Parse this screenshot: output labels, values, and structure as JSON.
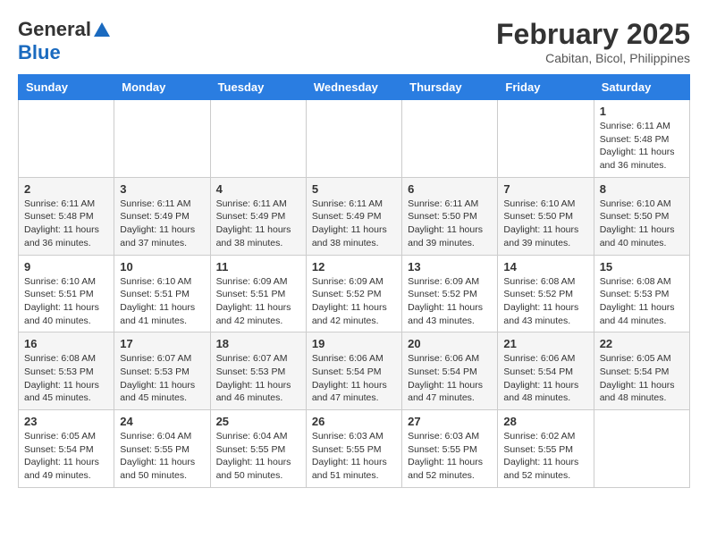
{
  "header": {
    "logo_general": "General",
    "logo_blue": "Blue",
    "month_title": "February 2025",
    "location": "Cabitan, Bicol, Philippines"
  },
  "days_of_week": [
    "Sunday",
    "Monday",
    "Tuesday",
    "Wednesday",
    "Thursday",
    "Friday",
    "Saturday"
  ],
  "weeks": [
    [
      {
        "day": "",
        "info": ""
      },
      {
        "day": "",
        "info": ""
      },
      {
        "day": "",
        "info": ""
      },
      {
        "day": "",
        "info": ""
      },
      {
        "day": "",
        "info": ""
      },
      {
        "day": "",
        "info": ""
      },
      {
        "day": "1",
        "info": "Sunrise: 6:11 AM\nSunset: 5:48 PM\nDaylight: 11 hours\nand 36 minutes."
      }
    ],
    [
      {
        "day": "2",
        "info": "Sunrise: 6:11 AM\nSunset: 5:48 PM\nDaylight: 11 hours\nand 36 minutes."
      },
      {
        "day": "3",
        "info": "Sunrise: 6:11 AM\nSunset: 5:49 PM\nDaylight: 11 hours\nand 37 minutes."
      },
      {
        "day": "4",
        "info": "Sunrise: 6:11 AM\nSunset: 5:49 PM\nDaylight: 11 hours\nand 38 minutes."
      },
      {
        "day": "5",
        "info": "Sunrise: 6:11 AM\nSunset: 5:49 PM\nDaylight: 11 hours\nand 38 minutes."
      },
      {
        "day": "6",
        "info": "Sunrise: 6:11 AM\nSunset: 5:50 PM\nDaylight: 11 hours\nand 39 minutes."
      },
      {
        "day": "7",
        "info": "Sunrise: 6:10 AM\nSunset: 5:50 PM\nDaylight: 11 hours\nand 39 minutes."
      },
      {
        "day": "8",
        "info": "Sunrise: 6:10 AM\nSunset: 5:50 PM\nDaylight: 11 hours\nand 40 minutes."
      }
    ],
    [
      {
        "day": "9",
        "info": "Sunrise: 6:10 AM\nSunset: 5:51 PM\nDaylight: 11 hours\nand 40 minutes."
      },
      {
        "day": "10",
        "info": "Sunrise: 6:10 AM\nSunset: 5:51 PM\nDaylight: 11 hours\nand 41 minutes."
      },
      {
        "day": "11",
        "info": "Sunrise: 6:09 AM\nSunset: 5:51 PM\nDaylight: 11 hours\nand 42 minutes."
      },
      {
        "day": "12",
        "info": "Sunrise: 6:09 AM\nSunset: 5:52 PM\nDaylight: 11 hours\nand 42 minutes."
      },
      {
        "day": "13",
        "info": "Sunrise: 6:09 AM\nSunset: 5:52 PM\nDaylight: 11 hours\nand 43 minutes."
      },
      {
        "day": "14",
        "info": "Sunrise: 6:08 AM\nSunset: 5:52 PM\nDaylight: 11 hours\nand 43 minutes."
      },
      {
        "day": "15",
        "info": "Sunrise: 6:08 AM\nSunset: 5:53 PM\nDaylight: 11 hours\nand 44 minutes."
      }
    ],
    [
      {
        "day": "16",
        "info": "Sunrise: 6:08 AM\nSunset: 5:53 PM\nDaylight: 11 hours\nand 45 minutes."
      },
      {
        "day": "17",
        "info": "Sunrise: 6:07 AM\nSunset: 5:53 PM\nDaylight: 11 hours\nand 45 minutes."
      },
      {
        "day": "18",
        "info": "Sunrise: 6:07 AM\nSunset: 5:53 PM\nDaylight: 11 hours\nand 46 minutes."
      },
      {
        "day": "19",
        "info": "Sunrise: 6:06 AM\nSunset: 5:54 PM\nDaylight: 11 hours\nand 47 minutes."
      },
      {
        "day": "20",
        "info": "Sunrise: 6:06 AM\nSunset: 5:54 PM\nDaylight: 11 hours\nand 47 minutes."
      },
      {
        "day": "21",
        "info": "Sunrise: 6:06 AM\nSunset: 5:54 PM\nDaylight: 11 hours\nand 48 minutes."
      },
      {
        "day": "22",
        "info": "Sunrise: 6:05 AM\nSunset: 5:54 PM\nDaylight: 11 hours\nand 48 minutes."
      }
    ],
    [
      {
        "day": "23",
        "info": "Sunrise: 6:05 AM\nSunset: 5:54 PM\nDaylight: 11 hours\nand 49 minutes."
      },
      {
        "day": "24",
        "info": "Sunrise: 6:04 AM\nSunset: 5:55 PM\nDaylight: 11 hours\nand 50 minutes."
      },
      {
        "day": "25",
        "info": "Sunrise: 6:04 AM\nSunset: 5:55 PM\nDaylight: 11 hours\nand 50 minutes."
      },
      {
        "day": "26",
        "info": "Sunrise: 6:03 AM\nSunset: 5:55 PM\nDaylight: 11 hours\nand 51 minutes."
      },
      {
        "day": "27",
        "info": "Sunrise: 6:03 AM\nSunset: 5:55 PM\nDaylight: 11 hours\nand 52 minutes."
      },
      {
        "day": "28",
        "info": "Sunrise: 6:02 AM\nSunset: 5:55 PM\nDaylight: 11 hours\nand 52 minutes."
      },
      {
        "day": "",
        "info": ""
      }
    ]
  ]
}
